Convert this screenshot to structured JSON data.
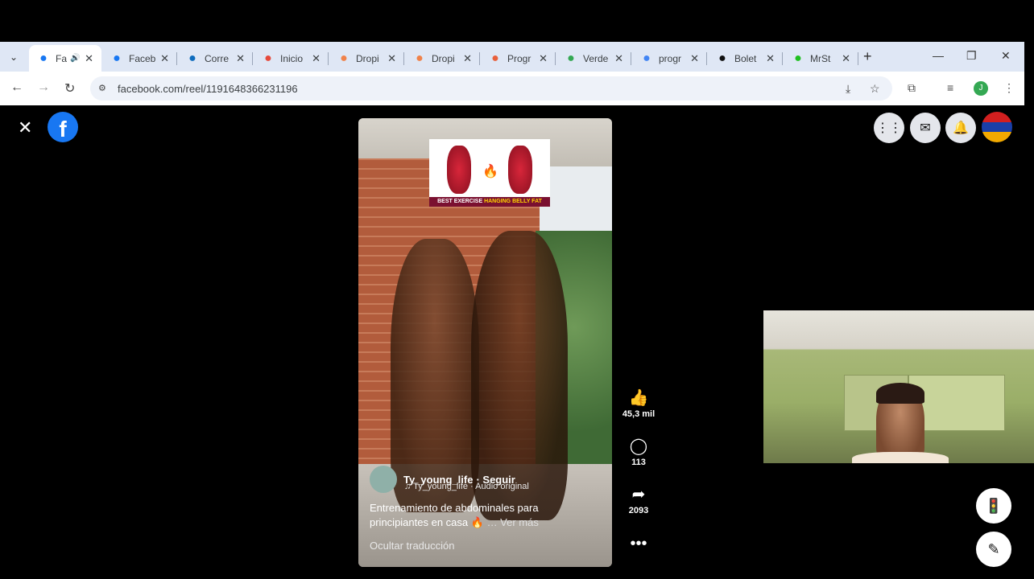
{
  "browser": {
    "tabs": [
      {
        "title": "Fa",
        "favicon": "facebook-icon",
        "favicon_color": "#1877f2",
        "active": true,
        "audio": true
      },
      {
        "title": "Faceb",
        "favicon": "facebook-icon",
        "favicon_color": "#1877f2"
      },
      {
        "title": "Corre",
        "favicon": "outlook-icon",
        "favicon_color": "#0f6cbd"
      },
      {
        "title": "Inicio",
        "favicon": "red-swirl-icon",
        "favicon_color": "#e64a3c"
      },
      {
        "title": "Dropi",
        "favicon": "dropi-icon",
        "favicon_color": "#f0824a"
      },
      {
        "title": "Dropi",
        "favicon": "dropi-icon",
        "favicon_color": "#f0824a"
      },
      {
        "title": "Progr",
        "favicon": "chat-icon",
        "favicon_color": "#e8603c"
      },
      {
        "title": "Verde",
        "favicon": "maps-pin-icon",
        "favicon_color": "#34a853"
      },
      {
        "title": "progr",
        "favicon": "google-icon",
        "favicon_color": "#4285f4"
      },
      {
        "title": "Bolet",
        "favicon": "t-icon",
        "favicon_color": "#111111"
      },
      {
        "title": "MrSt",
        "favicon": "k-icon",
        "favicon_color": "#20c020"
      }
    ],
    "url": "facebook.com/reel/1191648366231196",
    "profile_initial": "J"
  },
  "reel": {
    "thumb_caption_a": "BEST EXERCISE",
    "thumb_caption_b": "HANGING BELLY FAT",
    "owner": "Ty_young_life",
    "follow": "· Seguir",
    "audio": "♫ Ty_young_life · Audio original",
    "caption": "Entrenamiento de abdominales para principiantes en casa",
    "more": "🔥 … Ver más",
    "hide_translation": "Ocultar traducción",
    "likes": "45,3 mil",
    "comments": "113",
    "shares": "2093"
  },
  "colors": {
    "facebook_blue": "#1877f2",
    "page_bg": "#000000"
  }
}
